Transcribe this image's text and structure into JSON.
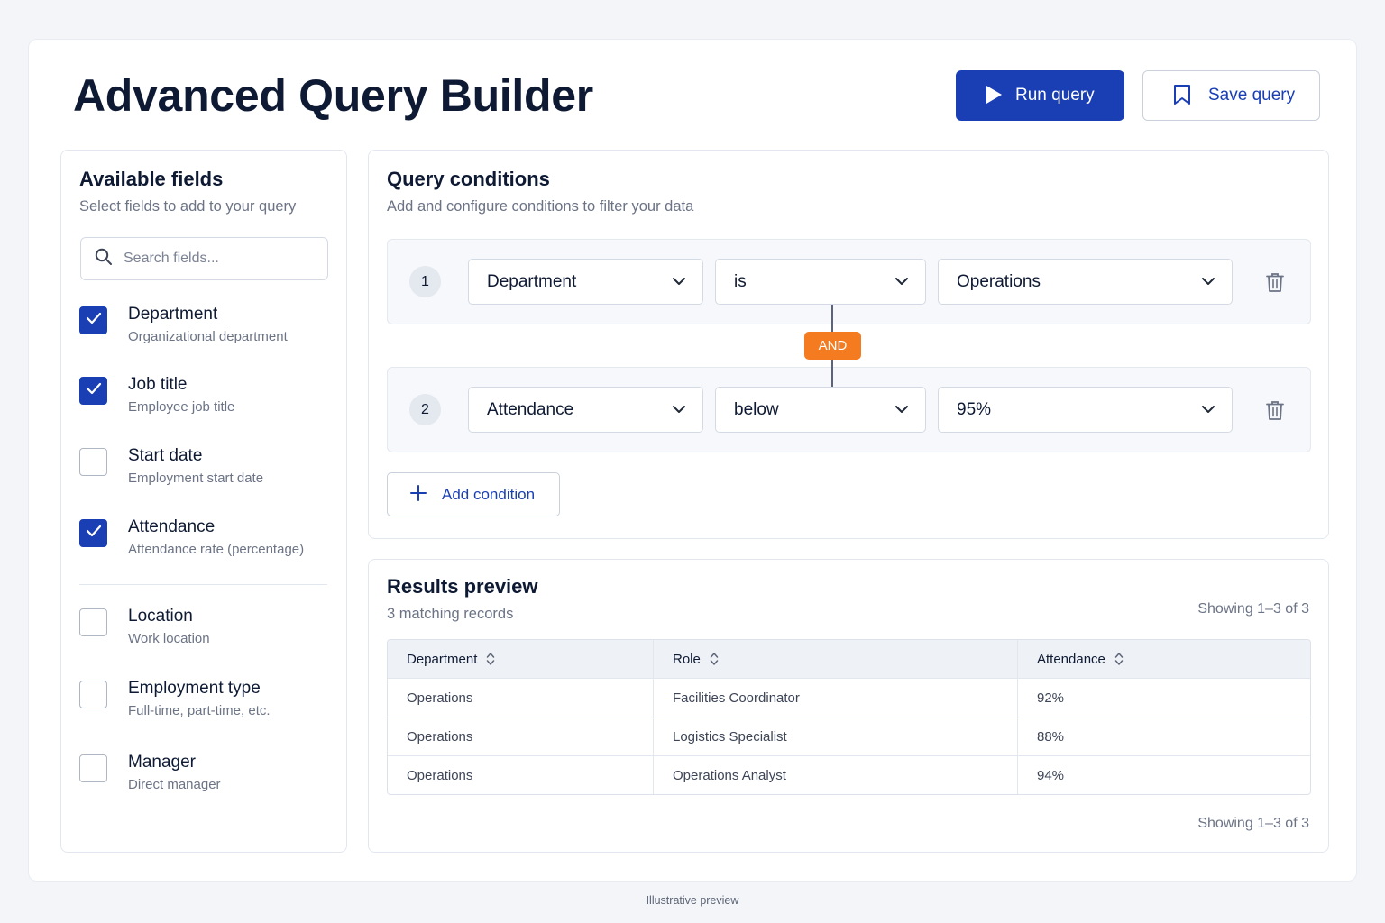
{
  "header": {
    "title": "Advanced Query Builder",
    "run_label": "Run query",
    "save_label": "Save query"
  },
  "fields_panel": {
    "title": "Available fields",
    "subtitle": "Select fields to add to your query",
    "search_placeholder": "Search fields...",
    "items": [
      {
        "name": "Department",
        "desc": "Organizational department",
        "checked": true
      },
      {
        "name": "Job title",
        "desc": "Employee job title",
        "checked": true
      },
      {
        "name": "Start date",
        "desc": "Employment start date",
        "checked": false
      },
      {
        "name": "Attendance",
        "desc": "Attendance rate (percentage)",
        "checked": true
      },
      {
        "name": "Location",
        "desc": "Work location",
        "checked": false
      },
      {
        "name": "Employment type",
        "desc": "Full-time, part-time, etc.",
        "checked": false
      },
      {
        "name": "Manager",
        "desc": "Direct manager",
        "checked": false
      }
    ]
  },
  "conditions_panel": {
    "title": "Query conditions",
    "subtitle": "Add and configure conditions to filter your data",
    "conditions": [
      {
        "number": "1",
        "field": "Department",
        "operator": "is",
        "value": "Operations"
      },
      {
        "number": "2",
        "field": "Attendance",
        "operator": "below",
        "value": "95%"
      }
    ],
    "connector": "AND",
    "add_label": "Add condition"
  },
  "results_panel": {
    "title": "Results preview",
    "subtitle": "3 matching records",
    "showing_top": "Showing 1–3 of 3",
    "showing_bottom": "Showing 1–3 of 3",
    "columns": [
      "Department",
      "Role",
      "Attendance"
    ],
    "rows": [
      [
        "Operations",
        "Facilities Coordinator",
        "92%"
      ],
      [
        "Operations",
        "Logistics Specialist",
        "88%"
      ],
      [
        "Operations",
        "Operations Analyst",
        "94%"
      ]
    ]
  },
  "footnote": "Illustrative preview",
  "colors": {
    "primary": "#1a3fb5",
    "accent_and": "#f47b20",
    "text_dark": "#0e1a33",
    "text_muted": "#6b7385"
  }
}
